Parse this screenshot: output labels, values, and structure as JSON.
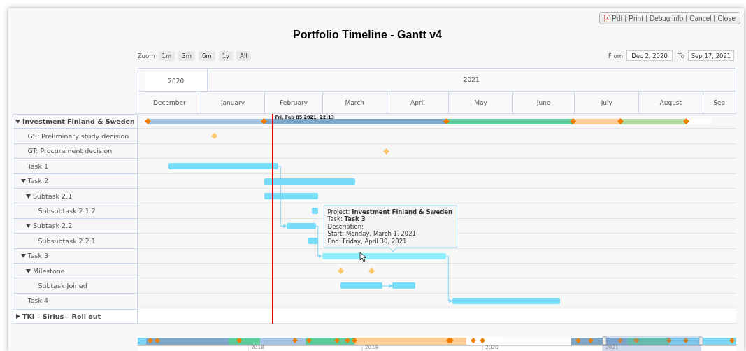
{
  "toolbar": [
    {
      "kind": "pdf",
      "label": "Pdf"
    },
    {
      "kind": "plain",
      "label": "Print"
    },
    {
      "kind": "plain",
      "label": "Debug info"
    },
    {
      "kind": "plain",
      "label": "Cancel"
    },
    {
      "kind": "plain",
      "label": "Close"
    }
  ],
  "title": "Portfolio Timeline - Gantt v4",
  "zoom": {
    "label": "Zoom",
    "buttons": [
      "1m",
      "3m",
      "6m",
      "1y",
      "All"
    ]
  },
  "range": {
    "from_label": "From",
    "from": "Dec 2, 2020",
    "to_label": "To",
    "to": "Sep 17, 2021"
  },
  "timeline": {
    "years": [
      "2020",
      "2021"
    ],
    "months": [
      "December",
      "January",
      "February",
      "March",
      "April",
      "May",
      "June",
      "July",
      "August",
      "Sep"
    ]
  },
  "now_marker": {
    "label": "Fri, Feb 05 2021, 22:13"
  },
  "gantt": {
    "rows": [
      {
        "label": "Investment Finland & Sweden",
        "kind": "project",
        "expanded": true,
        "hovered": false,
        "bars": [
          {
            "color": "#a5c5e2"
          },
          {
            "color": "#7ea6c6"
          },
          {
            "color": "#5fcb9c"
          },
          {
            "color": "#fdcb94"
          },
          {
            "color": "#b8dca4"
          },
          {
            "color": "#ffffff"
          }
        ],
        "diamonds": [
          {
            "color": "#f07c00"
          },
          {
            "color": "#f07c00"
          },
          {
            "color": "#f07c00"
          },
          {
            "color": "#f07c00"
          },
          {
            "color": "#f07c00"
          },
          {
            "color": "#f07c00"
          }
        ],
        "children": [
          {
            "label": "GS: Preliminary study decision",
            "kind": "task",
            "hovered": false,
            "diamonds": [
              {
                "color": "#fcc86a"
              }
            ]
          },
          {
            "label": "GT: Procurement decision",
            "kind": "task",
            "hovered": false,
            "diamonds": [
              {
                "color": "#fcc86a"
              }
            ]
          },
          {
            "label": "Task 1",
            "kind": "task",
            "hovered": false
          },
          {
            "label": "Task 2",
            "kind": "task",
            "expanded": true,
            "hovered": false,
            "children": [
              {
                "label": "Subtask 2.1",
                "kind": "task",
                "expanded": true,
                "hovered": false,
                "children": [
                  {
                    "label": "Subsubtask 2.1.2",
                    "kind": "task",
                    "hovered": false
                  }
                ]
              },
              {
                "label": "Subtask 2.2",
                "kind": "task",
                "expanded": true,
                "hovered": false,
                "children": [
                  {
                    "label": "Subsubtask 2.2.1",
                    "kind": "task",
                    "hovered": false
                  }
                ]
              }
            ]
          },
          {
            "label": "Task 3",
            "kind": "task",
            "expanded": true,
            "hovered": true,
            "children": [
              {
                "label": "Milestone",
                "kind": "task",
                "expanded": true,
                "hovered": false,
                "diamonds": [
                  {
                    "color": "#fcc86a"
                  },
                  {
                    "color": "#fcc86a"
                  }
                ],
                "children": [
                  {
                    "label": "Subtask Joined",
                    "kind": "task",
                    "hovered": false
                  }
                ]
              }
            ]
          },
          {
            "label": "Task 4",
            "kind": "task",
            "hovered": false
          }
        ]
      }
    ],
    "collapsed_rows": [
      {
        "label": "TKI – Sirius – Roll out",
        "kind": "project",
        "expanded": false
      }
    ]
  },
  "tooltip": {
    "lines": [
      "Project: **Investment Finland & Sweden**",
      "Task: **Task 3**",
      "Description:",
      "Start: Monday, March 1, 2021",
      "End: Friday, April 30, 2021"
    ]
  },
  "navigator": {
    "years": [
      "2018",
      "2019",
      "2020",
      "2021"
    ]
  }
}
